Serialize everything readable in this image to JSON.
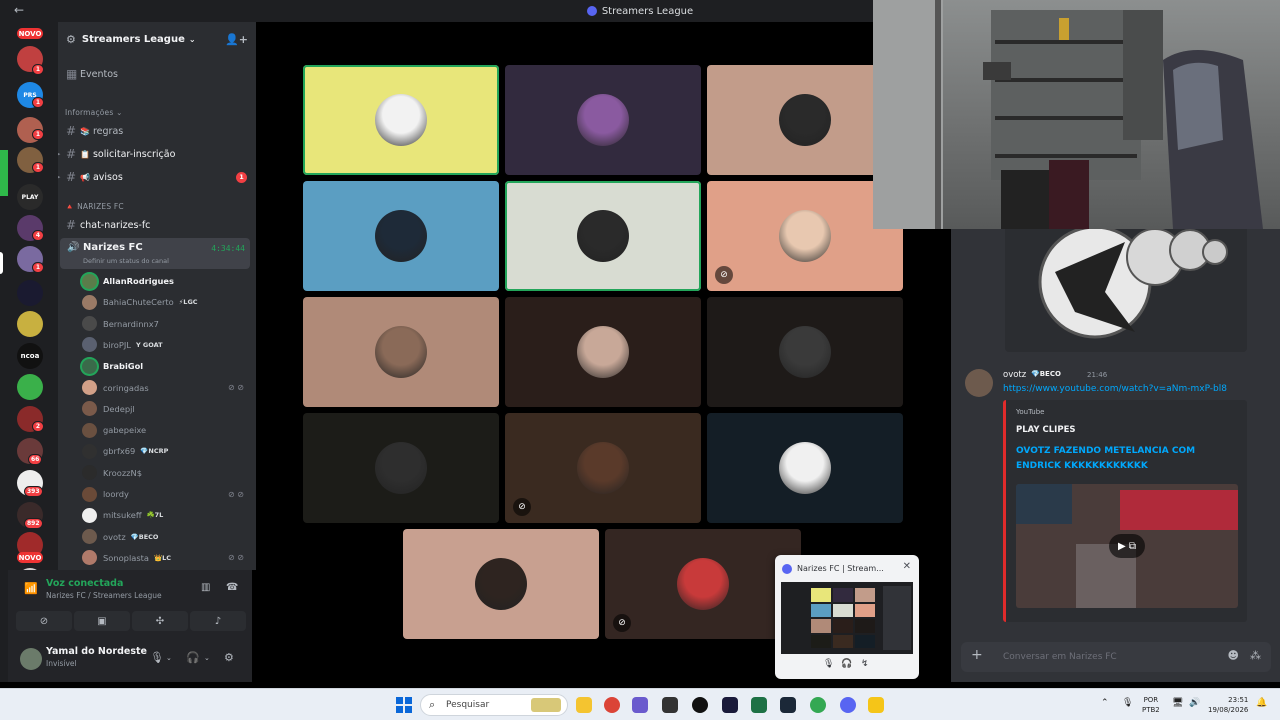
{
  "window": {
    "title": "Streamers League",
    "back_glyph": "←"
  },
  "rail": {
    "new_label": "NOVO",
    "new_label_bottom": "NOVO",
    "badges": [
      "1",
      "1",
      "1",
      "1",
      "4",
      "1",
      "66",
      "393",
      "892",
      "2",
      "2"
    ],
    "labels": {
      "play": "PLAY",
      "ncoa": "ncoa",
      "prs": "PRS"
    }
  },
  "server": {
    "name": "Streamers League",
    "events": "Eventos"
  },
  "channels": {
    "info_category": "Informações",
    "regras": "regras",
    "solicitar": "solicitar-inscrição",
    "avisos": "avisos",
    "avisos_badge": "1",
    "narizes_category": "NARIZES FC",
    "chat_channel": "chat-narizes-fc",
    "voice_channel": "Narizes FC",
    "voice_timer": "4:34:44",
    "voice_status": "Definir um status do canal"
  },
  "members": [
    {
      "name": "AllanRodrigues",
      "active": true,
      "tag": "",
      "color": "#5a7c4a"
    },
    {
      "name": "BahiaChuteCerto",
      "active": false,
      "tag": "⚡LGC",
      "color": "#9a7a66"
    },
    {
      "name": "Bernardinnx7",
      "active": false,
      "tag": "",
      "color": "#4a4a4a"
    },
    {
      "name": "biroPJL",
      "active": false,
      "tag": "Y GOAT",
      "color": "#5a6070"
    },
    {
      "name": "BrabiGol",
      "active": true,
      "tag": "",
      "color": "#3a6a4a"
    },
    {
      "name": "coringadas",
      "active": false,
      "tag": "",
      "color": "#d2a088"
    },
    {
      "name": "Dedepjl",
      "active": false,
      "tag": "",
      "color": "#7a5a4a"
    },
    {
      "name": "gabepeixe",
      "active": false,
      "tag": "",
      "color": "#6a5040"
    },
    {
      "name": "gbrfx69",
      "active": false,
      "tag": "💎NCRP",
      "color": "#303030"
    },
    {
      "name": "KroozzN$",
      "active": false,
      "tag": "",
      "color": "#2b2b2b"
    },
    {
      "name": "loordy",
      "active": false,
      "tag": "",
      "color": "#6a4a38"
    },
    {
      "name": "mitsukeff",
      "active": false,
      "tag": "☘️7L",
      "color": "#efefef"
    },
    {
      "name": "ovotz",
      "active": false,
      "tag": "💎BECO",
      "color": "#6d5a4d"
    },
    {
      "name": "Sonoplasta",
      "active": false,
      "tag": "👑LC",
      "color": "#b07a6a"
    }
  ],
  "voice_panel": {
    "status": "Voz conectada",
    "channel": "Narizes FC / Streamers League"
  },
  "user": {
    "name": "Yamal do Nordeste",
    "status": "Invisível"
  },
  "tiles": [
    {
      "bg": "#e8e67a",
      "av": "#f2f2f2",
      "speaking": true,
      "muted": false
    },
    {
      "bg": "#322a3e",
      "av": "#8a5aa0",
      "speaking": false,
      "muted": false
    },
    {
      "bg": "#c29c8a",
      "av": "#2a2a2a",
      "speaking": false,
      "muted": false
    },
    {
      "bg": "#5b9ec2",
      "av": "#1e2a38",
      "speaking": false,
      "muted": false
    },
    {
      "bg": "#d8dcd2",
      "av": "#2a2a2a",
      "speaking": true,
      "muted": false
    },
    {
      "bg": "#e0a088",
      "av": "#e8c8b0",
      "speaking": false,
      "muted": true
    },
    {
      "bg": "#b08a78",
      "av": "#8a6a58",
      "speaking": false,
      "muted": false
    },
    {
      "bg": "#2a1e1a",
      "av": "#c8a898",
      "speaking": false,
      "muted": false
    },
    {
      "bg": "#1e1a18",
      "av": "#3a3a3a",
      "speaking": false,
      "muted": false
    },
    {
      "bg": "#1c1c18",
      "av": "#2e2e2e",
      "speaking": false,
      "muted": false
    },
    {
      "bg": "#3a2a20",
      "av": "#5a3a2a",
      "speaking": false,
      "muted": true
    },
    {
      "bg": "#141e26",
      "av": "#f0f0f0",
      "speaking": false,
      "muted": false
    },
    {
      "bg": "#c8a090",
      "av": "#2e2420",
      "speaking": false,
      "muted": false
    },
    {
      "bg": "#342622",
      "av": "#c83a3a",
      "speaking": false,
      "muted": true
    }
  ],
  "chat": {
    "author": "ovotz",
    "author_tag": "💎BECO",
    "time": "21:46",
    "link": "https://www.youtube.com/watch?v=aNm-mxP-bl8",
    "embed_provider": "YouTube",
    "embed_author": "PLAY CLIPES",
    "embed_title": "OVOTZ FAZENDO METELANCIA COM ENDRICK KKKKKKKKKKKK",
    "input_placeholder": "Conversar em Narizes FC"
  },
  "pip": {
    "title": "Narizes FC | Stream..."
  },
  "taskbar": {
    "search_placeholder": "Pesquisar",
    "lang_top": "POR",
    "lang_bottom": "PTB2",
    "time": "23:51",
    "date": "19/08/2026"
  }
}
